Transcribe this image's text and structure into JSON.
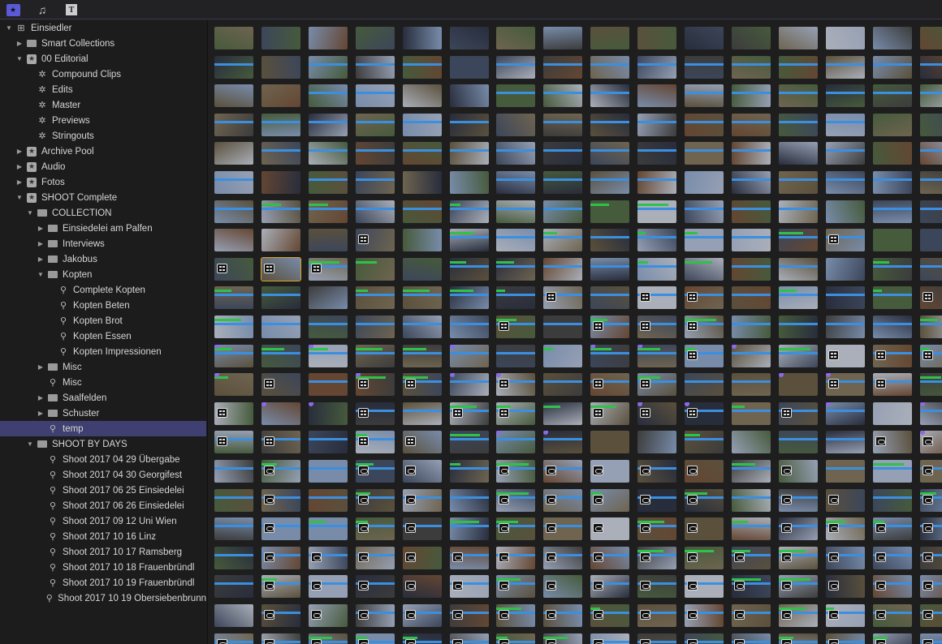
{
  "toolbar": {
    "icons": [
      "libraries-icon",
      "photos-audio-icon",
      "titles-generators-icon"
    ],
    "accent": "#5a5ad8"
  },
  "sidebar": {
    "items": [
      {
        "label": "Einsiedler",
        "level": 0,
        "icon": "library",
        "expanded": true
      },
      {
        "label": "Smart Collections",
        "level": 1,
        "icon": "folder",
        "expanded": false
      },
      {
        "label": "00 Editorial",
        "level": 1,
        "icon": "event",
        "expanded": true
      },
      {
        "label": "Compound Clips",
        "level": 2,
        "icon": "gear"
      },
      {
        "label": "Edits",
        "level": 2,
        "icon": "gear"
      },
      {
        "label": "Master",
        "level": 2,
        "icon": "gear"
      },
      {
        "label": "Previews",
        "level": 2,
        "icon": "gear"
      },
      {
        "label": "Stringouts",
        "level": 2,
        "icon": "gear"
      },
      {
        "label": "Archive Pool",
        "level": 1,
        "icon": "event",
        "expanded": false
      },
      {
        "label": "Audio",
        "level": 1,
        "icon": "event",
        "expanded": false
      },
      {
        "label": "Fotos",
        "level": 1,
        "icon": "event",
        "expanded": false
      },
      {
        "label": "SHOOT Complete",
        "level": 1,
        "icon": "event",
        "expanded": true
      },
      {
        "label": "COLLECTION",
        "level": 2,
        "icon": "folder",
        "expanded": true
      },
      {
        "label": "Einsiedelei am Palfen",
        "level": 3,
        "icon": "folder",
        "expanded": false
      },
      {
        "label": "Interviews",
        "level": 3,
        "icon": "folder",
        "expanded": false
      },
      {
        "label": "Jakobus",
        "level": 3,
        "icon": "folder",
        "expanded": false
      },
      {
        "label": "Kopten",
        "level": 3,
        "icon": "folder",
        "expanded": true
      },
      {
        "label": "Complete Kopten",
        "level": 4,
        "icon": "keyword"
      },
      {
        "label": "Kopten Beten",
        "level": 4,
        "icon": "keyword"
      },
      {
        "label": "Kopten Brot",
        "level": 4,
        "icon": "keyword"
      },
      {
        "label": "Kopten Essen",
        "level": 4,
        "icon": "keyword"
      },
      {
        "label": "Kopten Impressionen",
        "level": 4,
        "icon": "keyword"
      },
      {
        "label": "Misc",
        "level": 3,
        "icon": "folder",
        "expanded": false
      },
      {
        "label": "Misc",
        "level": 3,
        "icon": "keyword"
      },
      {
        "label": "Saalfelden",
        "level": 3,
        "icon": "folder",
        "expanded": false
      },
      {
        "label": "Schuster",
        "level": 3,
        "icon": "folder",
        "expanded": false
      },
      {
        "label": "temp",
        "level": 3,
        "icon": "keyword",
        "selected": true
      },
      {
        "label": "SHOOT BY DAYS",
        "level": 2,
        "icon": "folder",
        "expanded": true
      },
      {
        "label": "Shoot 2017 04 29 Übergabe",
        "level": 3,
        "icon": "keyword"
      },
      {
        "label": "Shoot 2017 04 30 Georgifest",
        "level": 3,
        "icon": "keyword"
      },
      {
        "label": "Shoot 2017 06 25 Einsiedelei",
        "level": 3,
        "icon": "keyword"
      },
      {
        "label": "Shoot 2017 06 26 Einsiedelei",
        "level": 3,
        "icon": "keyword"
      },
      {
        "label": "Shoot 2017 09 12 Uni Wien",
        "level": 3,
        "icon": "keyword"
      },
      {
        "label": "Shoot 2017 10 16 Linz",
        "level": 3,
        "icon": "keyword"
      },
      {
        "label": "Shoot 2017 10 17 Ramsberg",
        "level": 3,
        "icon": "keyword"
      },
      {
        "label": "Shoot 2017 10 18 Frauenbründl",
        "level": 3,
        "icon": "keyword"
      },
      {
        "label": "Shoot 2017 10 19 Frauenbründl",
        "level": 3,
        "icon": "keyword"
      },
      {
        "label": "Shoot 2017 10 19 Obersiebenbrunn",
        "level": 3,
        "icon": "keyword"
      }
    ]
  },
  "browser": {
    "selected_clip": [
      8,
      1
    ],
    "badges": [
      "................",
      "................",
      "................",
      "................",
      "................",
      "................",
      "................",
      "...c.........c..",
      "ccc.............",
      ".......c.cc....c",
      "......c.ccc.....",
      "..........c..ccc",
      ".c.cc.c.cc...cc.",
      "c..c.cc.ccc.c...",
      "cc.cc.........ss",
      ".s.ss.sssss.s..s",
      ".s.ss.sssss.ss.s",
      ".s.ss.sssss.ssss",
      ".sssssssssssssss",
      ".sssssssssssssss",
      ".sssssssssssssss",
      "ssssssssssssssss"
    ],
    "colors": {
      "bar": "#3b8fe0",
      "favorite": "#2fc24a",
      "marker": "#8a6ae8",
      "selection": "#d8a530"
    }
  }
}
